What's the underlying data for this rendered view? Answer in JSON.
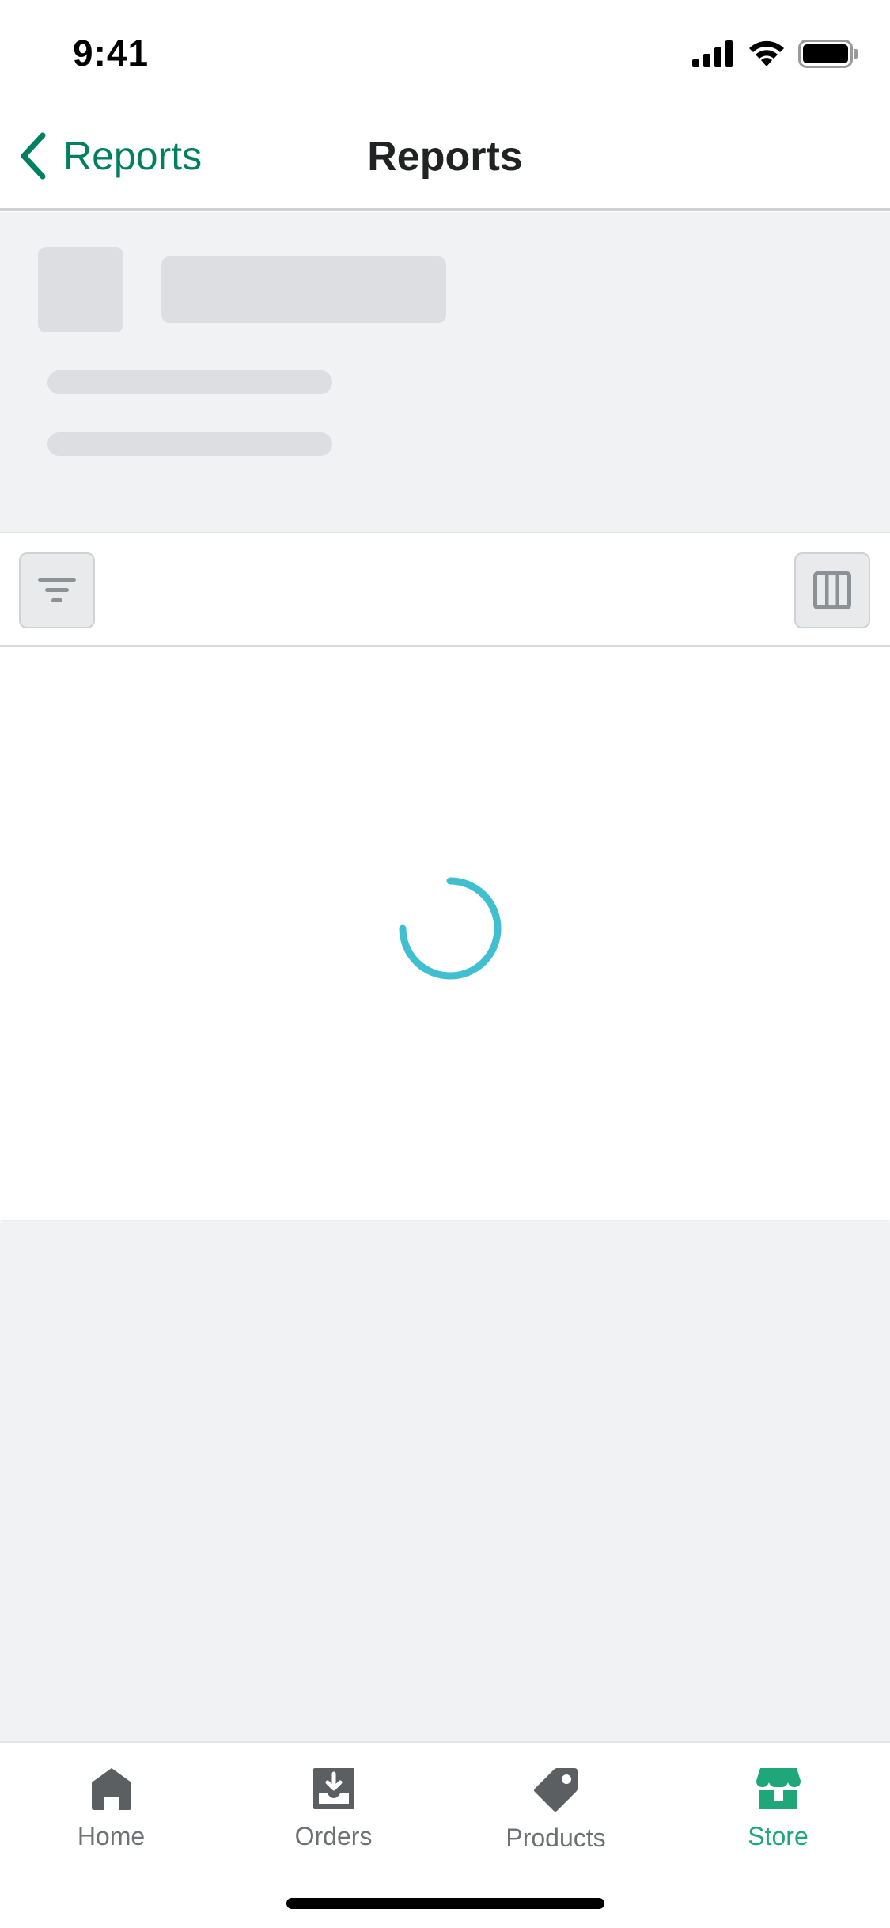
{
  "status_bar": {
    "time": "9:41"
  },
  "nav": {
    "back_label": "Reports",
    "title": "Reports"
  },
  "colors": {
    "accent": "#008060",
    "active_tab": "#1fa77a",
    "spinner": "#3fbfcf",
    "skeleton": "#dcdee2"
  },
  "toolbar": {
    "filter_icon": "filter-icon",
    "columns_icon": "columns-icon"
  },
  "loading": true,
  "tabs": [
    {
      "label": "Home",
      "icon": "home-icon",
      "active": false
    },
    {
      "label": "Orders",
      "icon": "orders-icon",
      "active": false
    },
    {
      "label": "Products",
      "icon": "tag-icon",
      "active": false
    },
    {
      "label": "Store",
      "icon": "store-icon",
      "active": true
    }
  ]
}
